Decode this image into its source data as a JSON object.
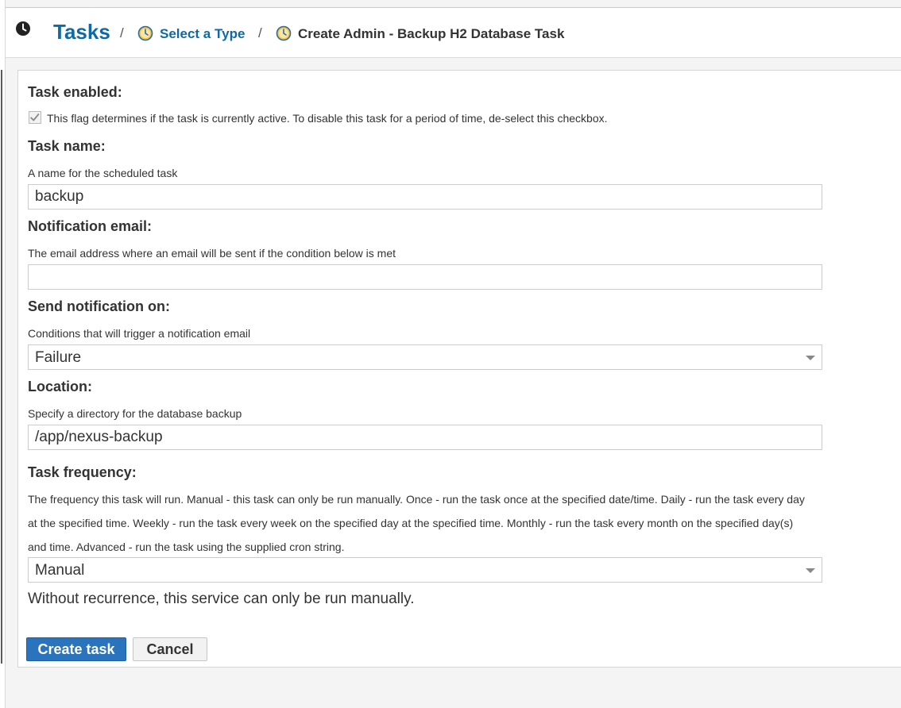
{
  "header": {
    "breadcrumb": {
      "root": "Tasks",
      "separator": "/",
      "middle": "Select a Type",
      "current": "Create Admin - Backup H2 Database Task"
    },
    "icon": "clock-icon"
  },
  "form": {
    "task_enabled": {
      "label": "Task enabled:",
      "help": "This flag determines if the task is currently active. To disable this task for a period of time, de-select this checkbox.",
      "checked": true
    },
    "task_name": {
      "label": "Task name:",
      "help": "A name for the scheduled task",
      "value": "backup"
    },
    "notification_email": {
      "label": "Notification email:",
      "help": "The email address where an email will be sent if the condition below is met",
      "value": ""
    },
    "send_notification_on": {
      "label": "Send notification on:",
      "help": "Conditions that will trigger a notification email",
      "value": "Failure"
    },
    "location": {
      "label": "Location:",
      "help": "Specify a directory for the database backup",
      "value": "/app/nexus-backup"
    },
    "task_frequency": {
      "label": "Task frequency:",
      "help": "The frequency this task will run. Manual - this task can only be run manually. Once - run the task once at the specified date/time. Daily - run the task every day at the specified time. Weekly - run the task every week on the specified day at the specified time. Monthly - run the task every month on the specified day(s) and time. Advanced - run the task using the supplied cron string.",
      "value": "Manual",
      "note": "Without recurrence, this service can only be run manually."
    }
  },
  "actions": {
    "create_label": "Create task",
    "cancel_label": "Cancel"
  },
  "colors": {
    "link": "#0e6aa6",
    "primary_button": "#2a73bd",
    "clock_icon_fill": "#f3c74a"
  }
}
